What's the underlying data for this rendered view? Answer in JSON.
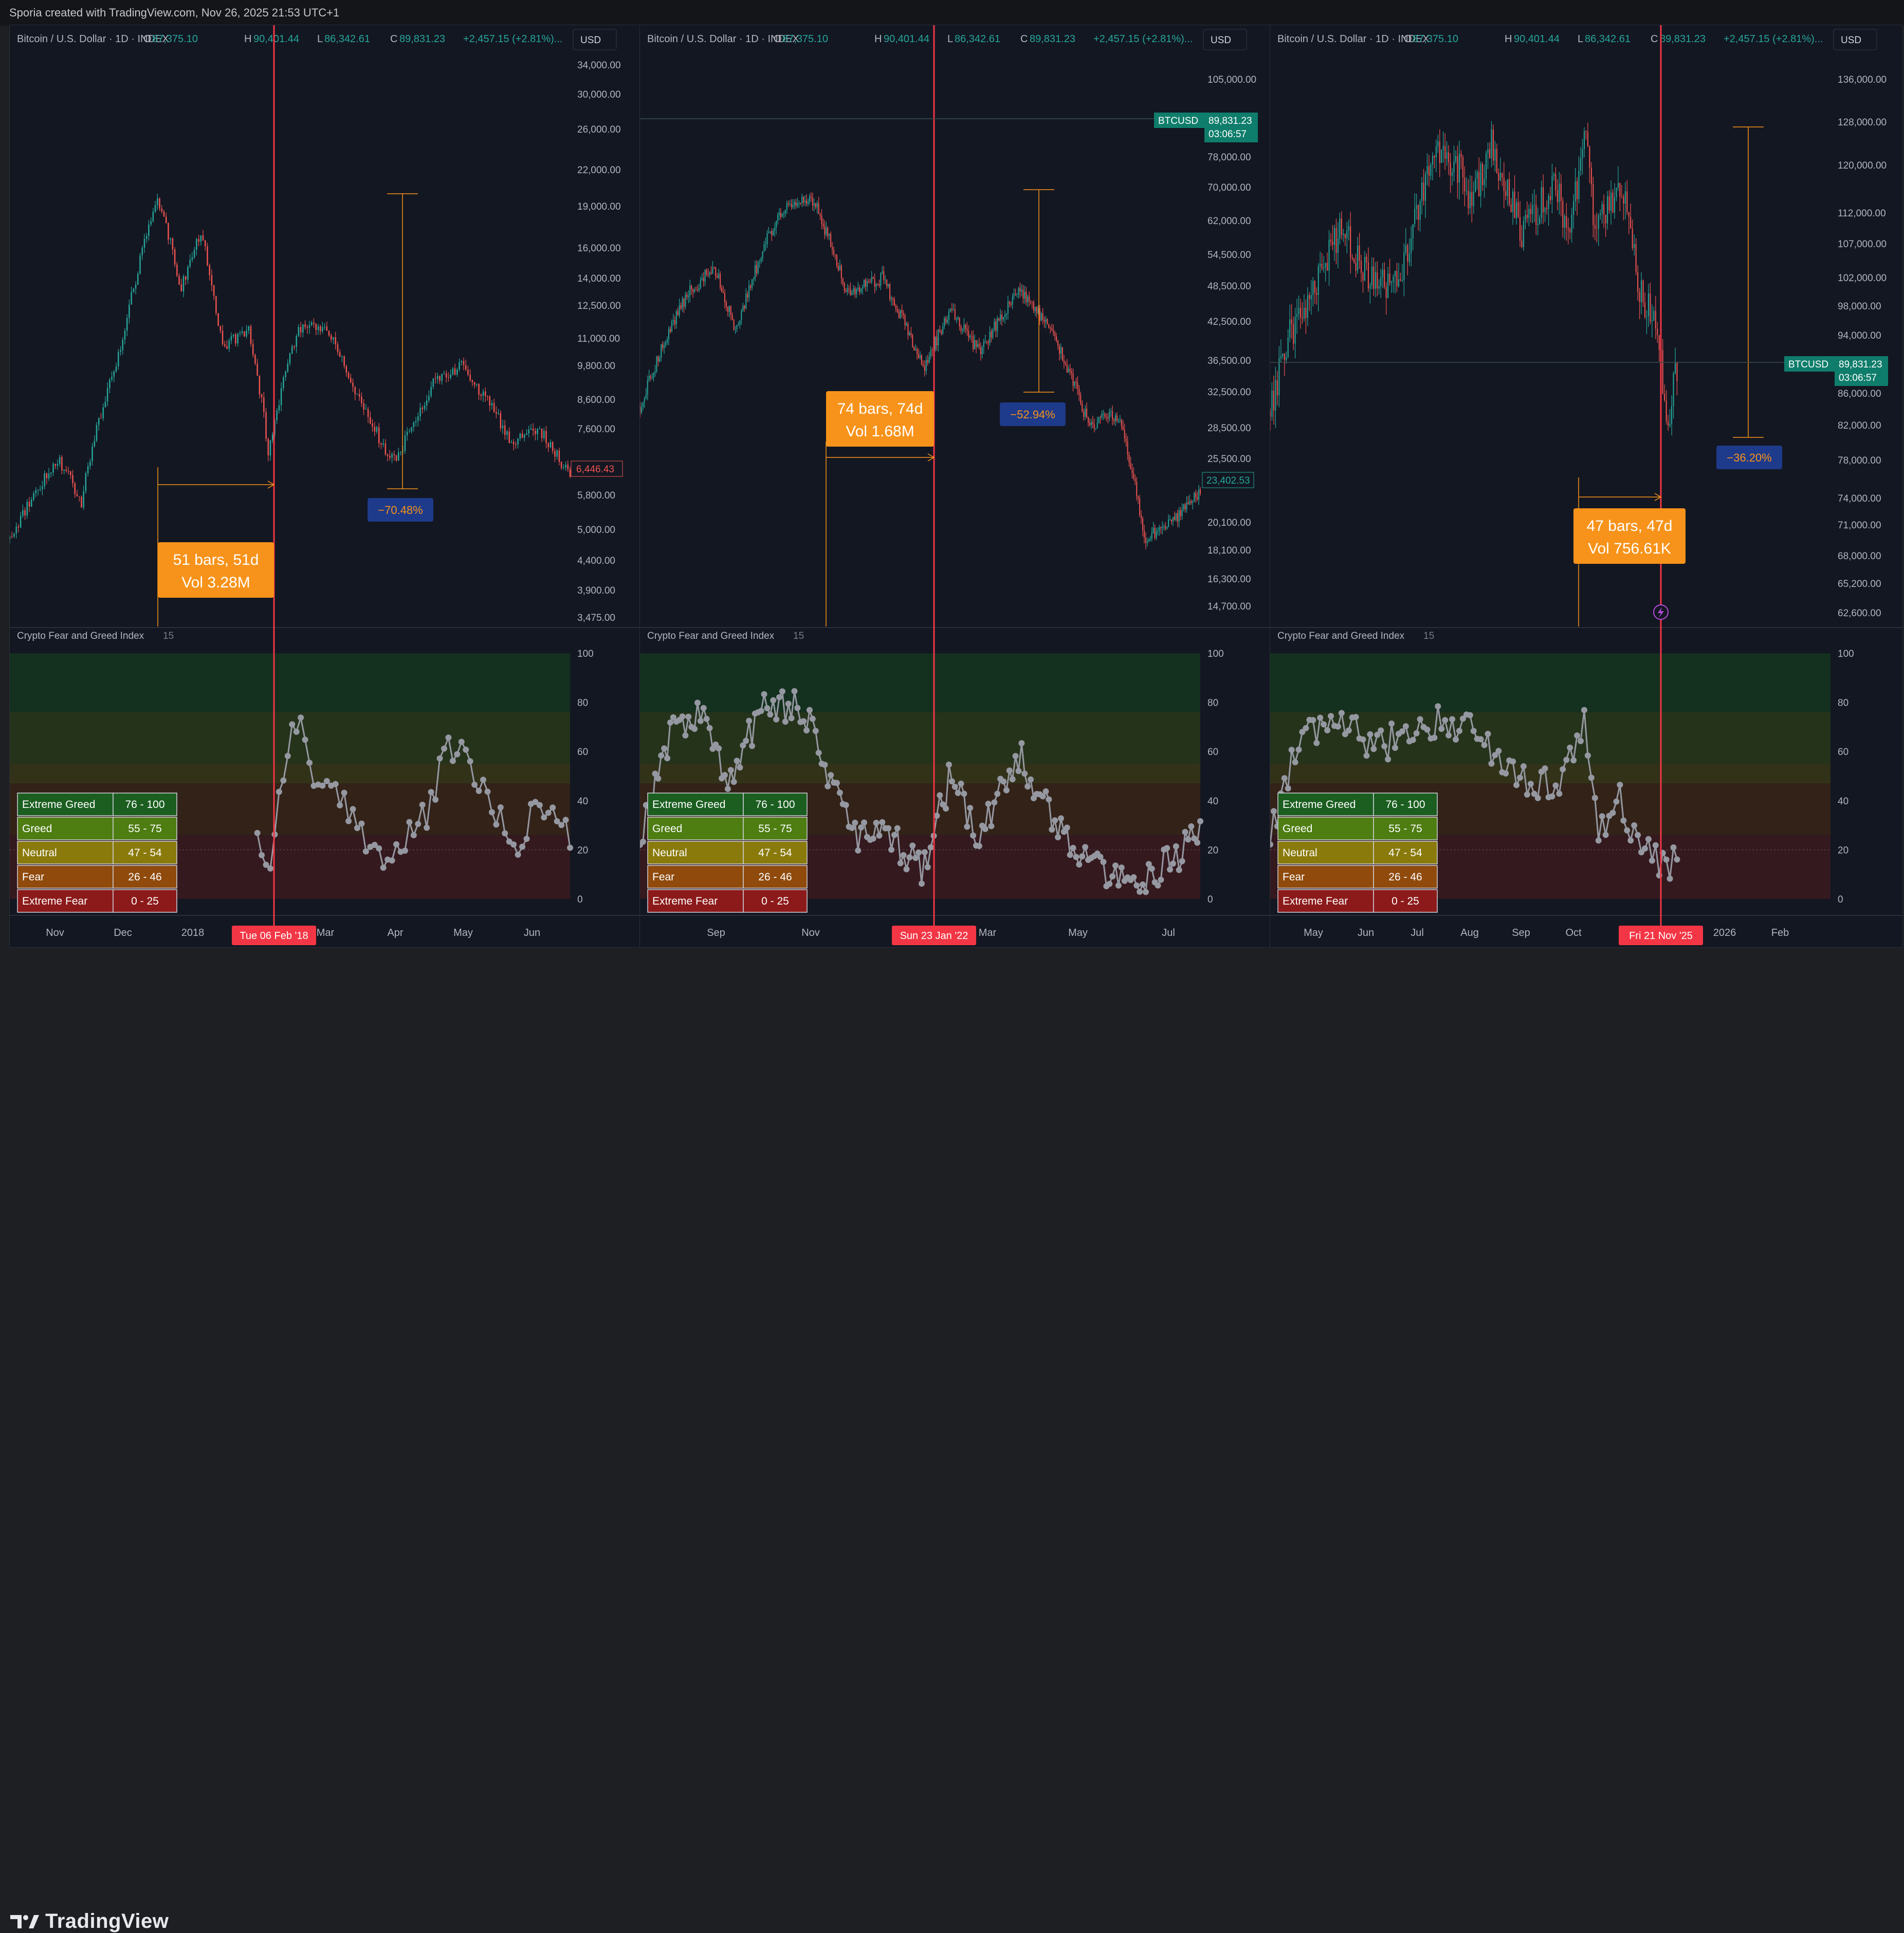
{
  "caption": "Sporia created with TradingView.com, Nov 26, 2025 21:53 UTC+1",
  "logo_text": "TradingView",
  "colors": {
    "background": "#131722",
    "up": "#26a69a",
    "down": "#ef5350",
    "crosshair": "#f23645",
    "measure": "#f7931a",
    "measure_label_bg": "#1e3a8a",
    "fgi_line": "#9598a1"
  },
  "fgi_legend": [
    {
      "label": "Extreme Greed",
      "range": "76 - 100",
      "color": "#1b5e20"
    },
    {
      "label": "Greed",
      "range": "55 - 75",
      "color": "#4e7d12"
    },
    {
      "label": "Neutral",
      "range": "47 - 54",
      "color": "#8a7a0c"
    },
    {
      "label": "Fear",
      "range": "26 - 46",
      "color": "#8f4a0c"
    },
    {
      "label": "Extreme Fear",
      "range": "0 - 25",
      "color": "#8c1a1a"
    }
  ],
  "panels": [
    {
      "header": {
        "symbol": "Bitcoin / U.S. Dollar · 1D · INDEX",
        "o_label": "O",
        "o": "87,375.10",
        "h_label": "H",
        "h": "90,401.44",
        "l_label": "L",
        "l": "86,342.61",
        "c_label": "C",
        "c": "89,831.23",
        "chg": "+2,457.15 (+2.81%)..."
      },
      "currency": "USD",
      "indicator_title": "Crypto Fear and Greed Index",
      "indicator_param": "15",
      "price_ticks": [
        "34,000.00",
        "30,000.00",
        "26,000.00",
        "22,000.00",
        "19,000.00",
        "16,000.00",
        "14,000.00",
        "12,500.00",
        "11,000.00",
        "9,800.00",
        "8,600.00",
        "7,600.00",
        "5,800.00",
        "5,000.00",
        "4,400.00",
        "3,900.00",
        "3,475.00"
      ],
      "ind_ticks": [
        "100",
        "80",
        "60",
        "40",
        "20",
        "0"
      ],
      "time_ticks": [
        "Nov",
        "Dec",
        "2018",
        "Mar",
        "Apr",
        "May",
        "Jun"
      ],
      "crosshair_date": "Tue 06 Feb '18",
      "price_badges": [
        {
          "text": "6,446.43",
          "style": "outline-red"
        }
      ],
      "measure": {
        "bars": "51 bars, 51d",
        "vol": "Vol 3.28M"
      },
      "pct": "−70.48%"
    },
    {
      "header": {
        "symbol": "Bitcoin / U.S. Dollar · 1D · INDEX",
        "o_label": "O",
        "o": "87,375.10",
        "h_label": "H",
        "h": "90,401.44",
        "l_label": "L",
        "l": "86,342.61",
        "c_label": "C",
        "c": "89,831.23",
        "chg": "+2,457.15 (+2.81%)..."
      },
      "currency": "USD",
      "indicator_title": "Crypto Fear and Greed Index",
      "indicator_param": "15",
      "price_ticks": [
        "105,000.00",
        "78,000.00",
        "70,000.00",
        "62,000.00",
        "54,500.00",
        "48,500.00",
        "42,500.00",
        "36,500.00",
        "32,500.00",
        "28,500.00",
        "25,500.00",
        "20,100.00",
        "18,100.00",
        "16,300.00",
        "14,700.00"
      ],
      "ind_ticks": [
        "100",
        "80",
        "60",
        "40",
        "20",
        "0"
      ],
      "time_ticks": [
        "Sep",
        "Nov",
        "2",
        "Mar",
        "May",
        "Jul"
      ],
      "crosshair_date": "Sun 23 Jan '22",
      "price_badges": [
        {
          "text": "BTCUSD",
          "style": "teal"
        },
        {
          "text": "89,831.23",
          "style": "teal"
        },
        {
          "text": "03:06:57",
          "style": "teal"
        },
        {
          "text": "23,402.53",
          "style": "outline-teal"
        }
      ],
      "measure": {
        "bars": "74 bars, 74d",
        "vol": "Vol 1.68M"
      },
      "pct": "−52.94%"
    },
    {
      "header": {
        "symbol": "Bitcoin / U.S. Dollar · 1D · INDEX",
        "o_label": "O",
        "o": "87,375.10",
        "h_label": "H",
        "h": "90,401.44",
        "l_label": "L",
        "l": "86,342.61",
        "c_label": "C",
        "c": "89,831.23",
        "chg": "+2,457.15 (+2.81%)..."
      },
      "currency": "USD",
      "indicator_title": "Crypto Fear and Greed Index",
      "indicator_param": "15",
      "price_ticks": [
        "136,000.00",
        "128,000.00",
        "120,000.00",
        "112,000.00",
        "107,000.00",
        "102,000.00",
        "98,000.00",
        "94,000.00",
        "86,000.00",
        "82,000.00",
        "78,000.00",
        "74,000.00",
        "71,000.00",
        "68,000.00",
        "65,200.00",
        "62,600.00"
      ],
      "ind_ticks": [
        "100",
        "80",
        "60",
        "40",
        "20",
        "0"
      ],
      "time_ticks": [
        "May",
        "Jun",
        "Jul",
        "Aug",
        "Sep",
        "Oct",
        "N",
        "2026",
        "Feb"
      ],
      "crosshair_date": "Fri 21 Nov '25",
      "price_badges": [
        {
          "text": "BTCUSD",
          "style": "teal"
        },
        {
          "text": "89,831.23",
          "style": "teal"
        },
        {
          "text": "03:06:57",
          "style": "teal"
        }
      ],
      "measure": {
        "bars": "47 bars, 47d",
        "vol": "Vol 756.61K"
      },
      "pct": "−36.20%"
    }
  ],
  "chart_data": [
    {
      "type": "candlestick",
      "title": "Bitcoin / U.S. Dollar · 1D · INDEX",
      "scale": "log",
      "ylim": [
        3475,
        34000
      ],
      "x_start": "2017-10-10",
      "x_end": "2018-06-25",
      "event_date": "2018-02-06",
      "path": [
        [
          "2017-10-10",
          4800
        ],
        [
          "2017-11-01",
          6700
        ],
        [
          "2017-11-12",
          5600
        ],
        [
          "2017-12-01",
          10800
        ],
        [
          "2017-12-17",
          19500
        ],
        [
          "2017-12-28",
          13500
        ],
        [
          "2018-01-06",
          17000
        ],
        [
          "2018-01-16",
          10500
        ],
        [
          "2018-01-28",
          11500
        ],
        [
          "2018-02-06",
          6900
        ],
        [
          "2018-02-20",
          11400
        ],
        [
          "2018-03-05",
          11500
        ],
        [
          "2018-03-20",
          8500
        ],
        [
          "2018-04-01",
          6900
        ],
        [
          "2018-04-06",
          6600
        ],
        [
          "2018-04-25",
          9400
        ],
        [
          "2018-05-06",
          9800
        ],
        [
          "2018-05-29",
          7200
        ],
        [
          "2018-06-10",
          7600
        ],
        [
          "2018-06-25",
          6200
        ]
      ],
      "annotations": {
        "measure": "51 bars, 51d / Vol 3.28M",
        "pct_change": "−70.48%"
      },
      "indicator": {
        "name": "Crypto Fear and Greed Index",
        "param": "15",
        "ylim": [
          0,
          100
        ],
        "path": [
          [
            "2018-02-01",
            30
          ],
          [
            "2018-02-06",
            8
          ],
          [
            "2018-02-13",
            55
          ],
          [
            "2018-02-20",
            74
          ],
          [
            "2018-03-01",
            45
          ],
          [
            "2018-03-10",
            40
          ],
          [
            "2018-03-20",
            30
          ],
          [
            "2018-04-01",
            15
          ],
          [
            "2018-04-10",
            22
          ],
          [
            "2018-04-20",
            35
          ],
          [
            "2018-05-01",
            63
          ],
          [
            "2018-05-10",
            55
          ],
          [
            "2018-05-20",
            35
          ],
          [
            "2018-06-01",
            22
          ],
          [
            "2018-06-10",
            40
          ],
          [
            "2018-06-25",
            25
          ]
        ]
      }
    },
    {
      "type": "candlestick",
      "title": "Bitcoin / U.S. Dollar · 1D · INDEX",
      "scale": "log",
      "ylim": [
        14700,
        105000
      ],
      "x_start": "2021-07-20",
      "x_end": "2022-07-25",
      "event_date": "2022-01-23",
      "path": [
        [
          "2021-07-20",
          31000
        ],
        [
          "2021-08-20",
          47000
        ],
        [
          "2021-09-07",
          52000
        ],
        [
          "2021-09-21",
          41000
        ],
        [
          "2021-10-20",
          64000
        ],
        [
          "2021-11-10",
          68000
        ],
        [
          "2021-12-04",
          47000
        ],
        [
          "2021-12-27",
          50000
        ],
        [
          "2022-01-23",
          35500
        ],
        [
          "2022-02-10",
          44000
        ],
        [
          "2022-03-01",
          38000
        ],
        [
          "2022-03-28",
          47500
        ],
        [
          "2022-04-20",
          40000
        ],
        [
          "2022-05-12",
          29000
        ],
        [
          "2022-06-01",
          30000
        ],
        [
          "2022-06-18",
          19000
        ],
        [
          "2022-07-01",
          19500
        ],
        [
          "2022-07-25",
          22500
        ]
      ],
      "annotations": {
        "measure": "74 bars, 74d / Vol 1.68M",
        "pct_change": "−52.94%"
      },
      "indicator": {
        "name": "Crypto Fear and Greed Index",
        "param": "15",
        "ylim": [
          0,
          100
        ],
        "path": [
          [
            "2021-07-20",
            25
          ],
          [
            "2021-08-10",
            70
          ],
          [
            "2021-09-01",
            75
          ],
          [
            "2021-09-15",
            45
          ],
          [
            "2021-10-10",
            80
          ],
          [
            "2021-11-05",
            78
          ],
          [
            "2021-11-25",
            45
          ],
          [
            "2021-12-10",
            25
          ],
          [
            "2022-01-01",
            25
          ],
          [
            "2022-01-23",
            12
          ],
          [
            "2022-02-10",
            50
          ],
          [
            "2022-03-01",
            25
          ],
          [
            "2022-03-28",
            58
          ],
          [
            "2022-04-20",
            30
          ],
          [
            "2022-05-20",
            12
          ],
          [
            "2022-06-18",
            7
          ],
          [
            "2022-07-10",
            18
          ],
          [
            "2022-07-25",
            28
          ]
        ]
      }
    },
    {
      "type": "candlestick",
      "title": "Bitcoin / U.S. Dollar · 1D · INDEX",
      "scale": "log",
      "ylim": [
        62600,
        136000
      ],
      "x_start": "2025-04-12",
      "x_end": "2026-02-20",
      "event_date": "2025-11-21",
      "last_price": 89831.23,
      "path": [
        [
          "2025-04-12",
          84000
        ],
        [
          "2025-04-22",
          93000
        ],
        [
          "2025-05-10",
          103000
        ],
        [
          "2025-05-22",
          110000
        ],
        [
          "2025-06-05",
          102000
        ],
        [
          "2025-06-22",
          101000
        ],
        [
          "2025-07-14",
          122000
        ],
        [
          "2025-07-28",
          119000
        ],
        [
          "2025-08-02",
          113000
        ],
        [
          "2025-08-14",
          123500
        ],
        [
          "2025-08-31",
          108500
        ],
        [
          "2025-09-18",
          117000
        ],
        [
          "2025-09-26",
          109000
        ],
        [
          "2025-10-06",
          125000
        ],
        [
          "2025-10-10",
          111000
        ],
        [
          "2025-10-27",
          115000
        ],
        [
          "2025-11-04",
          101000
        ],
        [
          "2025-11-14",
          95000
        ],
        [
          "2025-11-21",
          83000
        ],
        [
          "2025-11-26",
          89831
        ]
      ],
      "annotations": {
        "measure": "47 bars, 47d / Vol 756.61K",
        "pct_change": "−36.20%"
      },
      "indicator": {
        "name": "Crypto Fear and Greed Index",
        "param": "15",
        "ylim": [
          0,
          100
        ],
        "path": [
          [
            "2025-04-12",
            25
          ],
          [
            "2025-04-25",
            60
          ],
          [
            "2025-05-10",
            70
          ],
          [
            "2025-05-25",
            72
          ],
          [
            "2025-06-10",
            60
          ],
          [
            "2025-06-25",
            68
          ],
          [
            "2025-07-15",
            73
          ],
          [
            "2025-08-05",
            70
          ],
          [
            "2025-08-20",
            55
          ],
          [
            "2025-09-05",
            48
          ],
          [
            "2025-09-20",
            45
          ],
          [
            "2025-10-05",
            72
          ],
          [
            "2025-10-12",
            28
          ],
          [
            "2025-10-25",
            40
          ],
          [
            "2025-11-05",
            22
          ],
          [
            "2025-11-14",
            15
          ],
          [
            "2025-11-21",
            11
          ],
          [
            "2025-11-26",
            20
          ]
        ]
      }
    }
  ]
}
